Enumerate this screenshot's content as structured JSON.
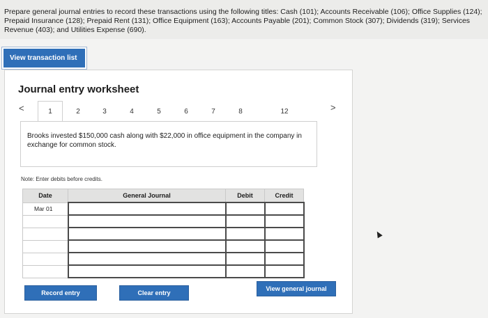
{
  "instructions": "Prepare general journal entries to record these transactions using the following titles: Cash (101); Accounts Receivable (106); Office Supplies (124); Prepaid Insurance (128); Prepaid Rent (131); Office Equipment (163); Accounts Payable (201); Common Stock (307); Dividends (319); Services Revenue (403); and Utilities Expense (690).",
  "view_transaction_list": "View transaction list",
  "worksheet": {
    "title": "Journal entry worksheet",
    "prev_arrow": "<",
    "next_arrow": ">",
    "tabs": [
      "1",
      "2",
      "3",
      "4",
      "5",
      "6",
      "7",
      "8",
      "12"
    ],
    "active_tab": "1",
    "prompt": "Brooks invested $150,000 cash along with $22,000 in office equipment in the company in exchange for common stock.",
    "note": "Note: Enter debits before credits.",
    "columns": {
      "date": "Date",
      "general_journal": "General Journal",
      "debit": "Debit",
      "credit": "Credit"
    },
    "rows": [
      {
        "date": "Mar 01"
      },
      {
        "date": ""
      },
      {
        "date": ""
      },
      {
        "date": ""
      },
      {
        "date": ""
      },
      {
        "date": ""
      }
    ]
  },
  "buttons": {
    "record_entry": "Record entry",
    "clear_entry": "Clear entry",
    "view_general_journal": "View general journal"
  },
  "colors": {
    "button_blue": "#2f6fb8",
    "header_gray": "#e2e2e1"
  }
}
